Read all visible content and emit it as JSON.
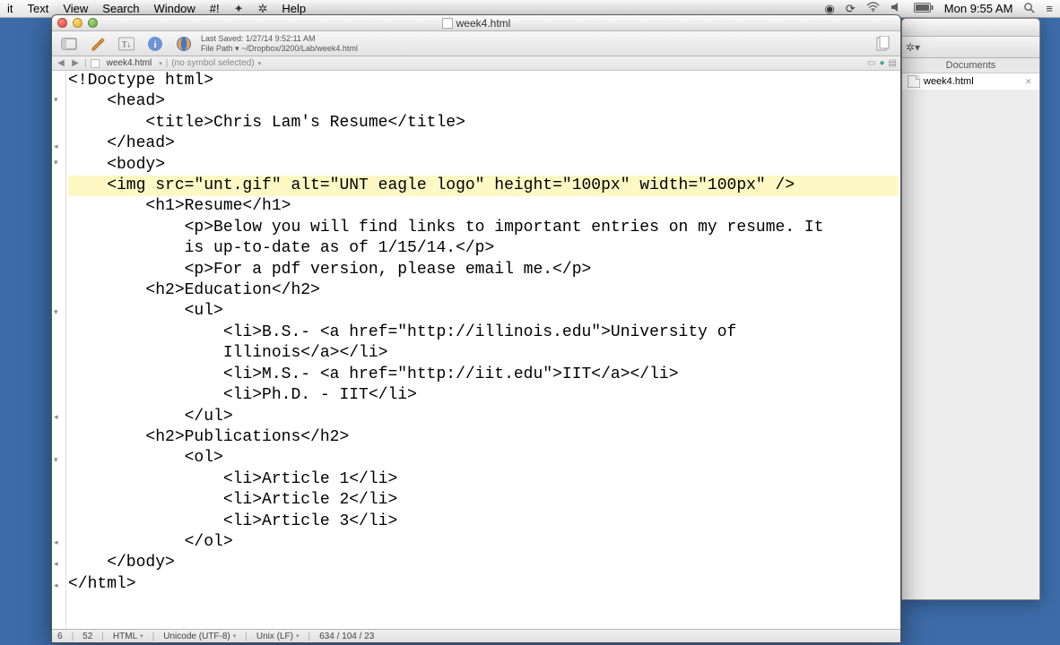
{
  "menubar": {
    "items": [
      "it",
      "Text",
      "View",
      "Search",
      "Window",
      "#!",
      "Help"
    ],
    "clock": "Mon 9:55 AM"
  },
  "back_window": {
    "panel_title": "Documents",
    "file": "week4.html"
  },
  "window": {
    "title": "week4.html",
    "last_saved_label": "Last Saved:",
    "last_saved_value": "1/27/14 9:52:11 AM",
    "file_path_label": "File Path ▾",
    "file_path_value": "~/Dropbox/3200/Lab/week4.html",
    "breadcrumb_file": "week4.html",
    "symbol_selector": "(no symbol selected)"
  },
  "code_lines": [
    "<!Doctype html>",
    "    <head>",
    "        <title>Chris Lam's Resume</title>",
    "    </head>",
    "    <body>",
    "    <img src=\"unt.gif\" alt=\"UNT eagle logo\" height=\"100px\" width=\"100px\" />",
    "        <h1>Resume</h1>",
    "            <p>Below you will find links to important entries on my resume. It",
    "            is up-to-date as of 1/15/14.</p>",
    "            <p>For a pdf version, please email me.</p>",
    "        <h2>Education</h2>",
    "            <ul>",
    "                <li>B.S.- <a href=\"http://illinois.edu\">University of",
    "                Illinois</a></li>",
    "                <li>M.S.- <a href=\"http://iit.edu\">IIT</a></li>",
    "                <li>Ph.D. - IIT</li>",
    "            </ul>",
    "        <h2>Publications</h2>",
    "            <ol>",
    "                <li>Article 1</li>",
    "                <li>Article 2</li>",
    "                <li>Article 3</li>",
    "            </ol>",
    "    </body>",
    "</html>"
  ],
  "highlighted_line_index": 5,
  "status": {
    "line_col": "6",
    "col": "52",
    "language": "HTML",
    "encoding": "Unicode (UTF-8)",
    "line_ending": "Unix (LF)",
    "size": "634 / 104 / 23"
  }
}
